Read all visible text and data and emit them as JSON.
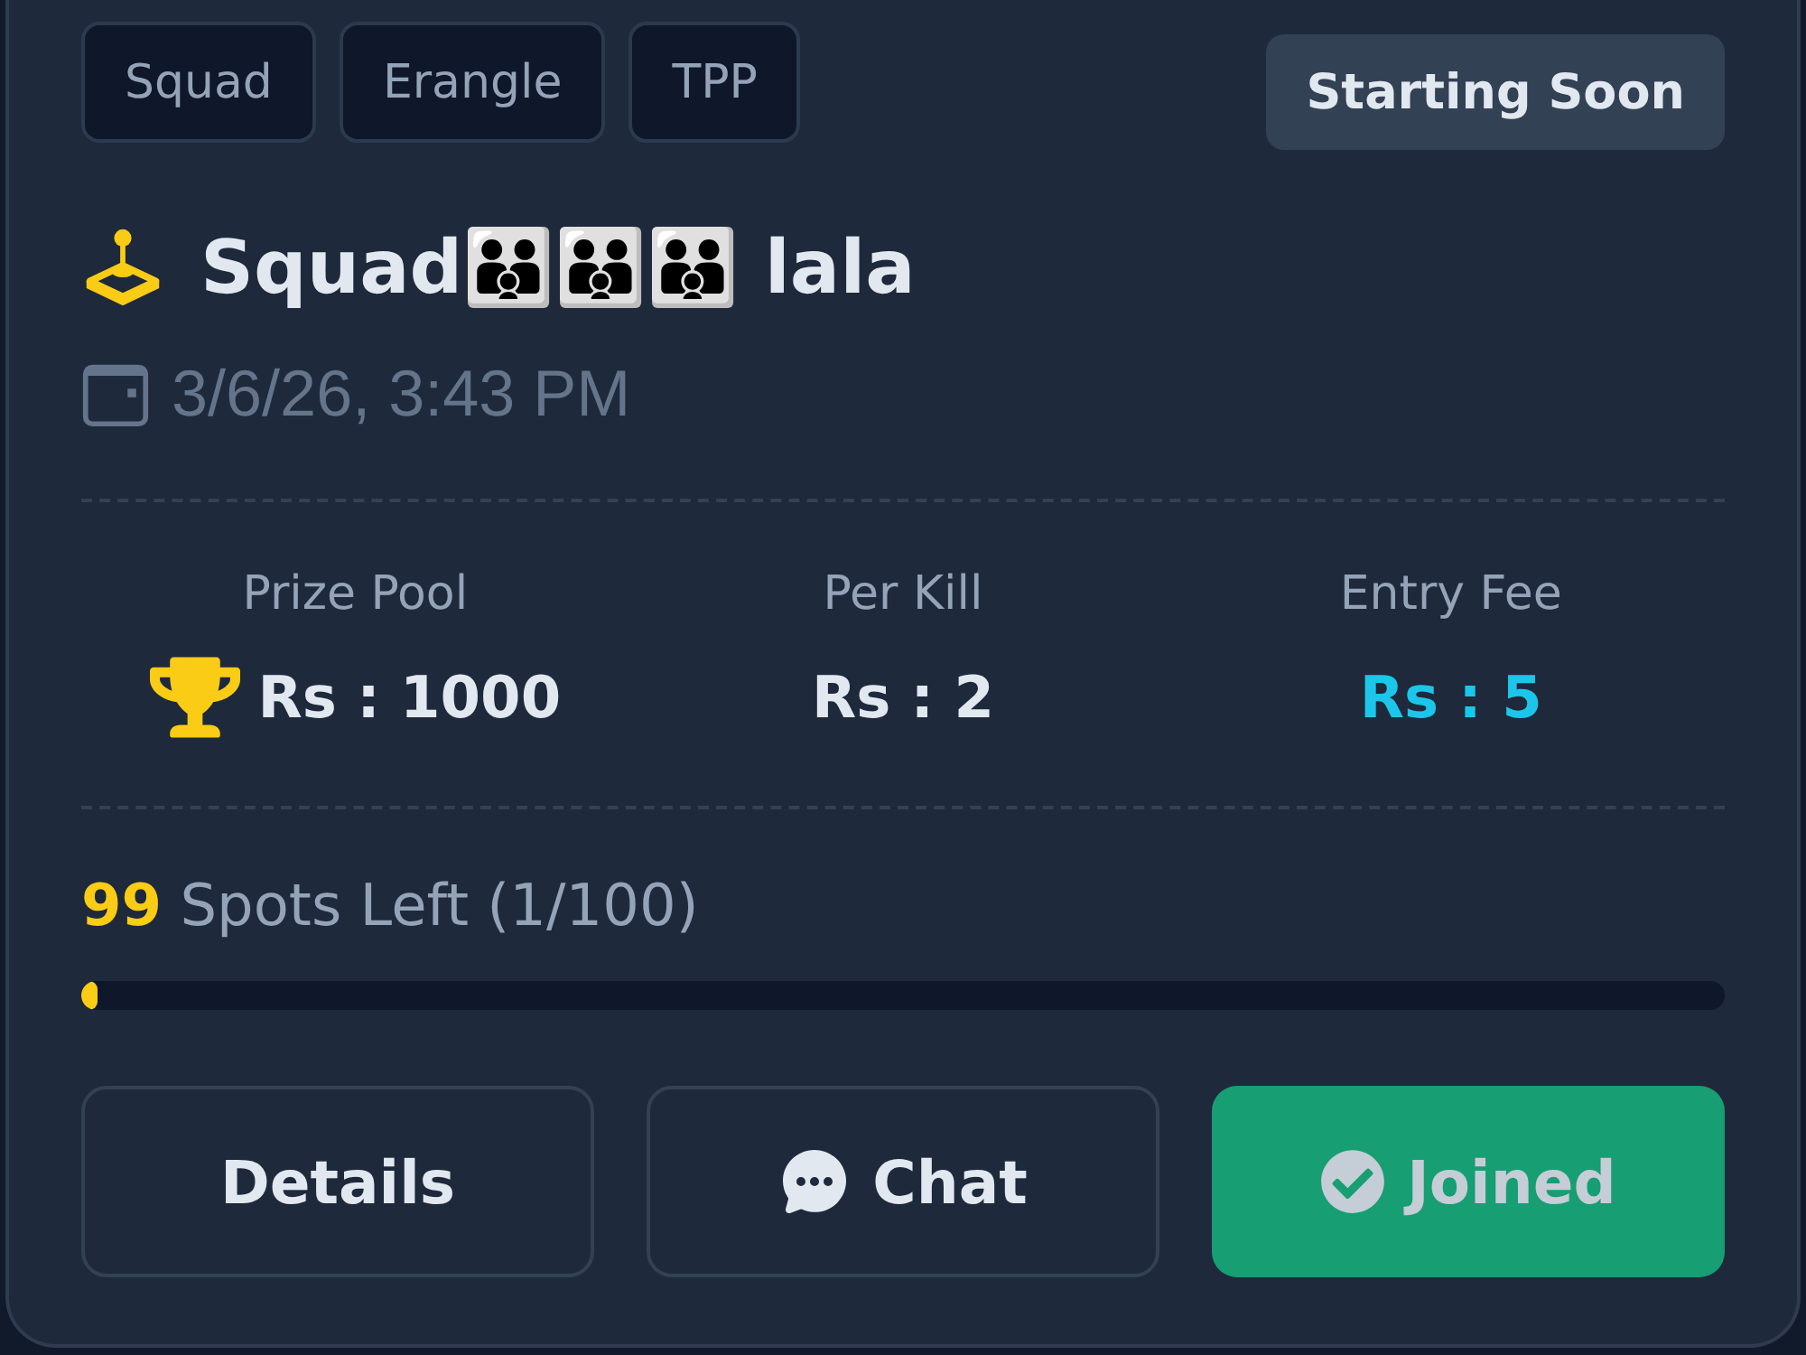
{
  "tags": [
    "Squad",
    "Erangle",
    "TPP"
  ],
  "status": "Starting Soon",
  "title": "Squad👪👪👪 lala",
  "date": "3/6/26, 3:43 PM",
  "stats": [
    {
      "label": "Prize Pool",
      "value": "Rs : 1000",
      "kind": "prize"
    },
    {
      "label": "Per Kill",
      "value": "Rs : 2",
      "kind": "plain"
    },
    {
      "label": "Entry Fee",
      "value": "Rs : 5",
      "kind": "fee"
    }
  ],
  "spots": {
    "text": "**99** Spots Left (1/100)",
    "level": 0.01
  },
  "buttons": [
    {
      "label": "Details",
      "kind": "outline"
    },
    {
      "label": "Chat",
      "kind": "chat"
    },
    {
      "label": "Joined",
      "kind": "joined"
    }
  ]
}
